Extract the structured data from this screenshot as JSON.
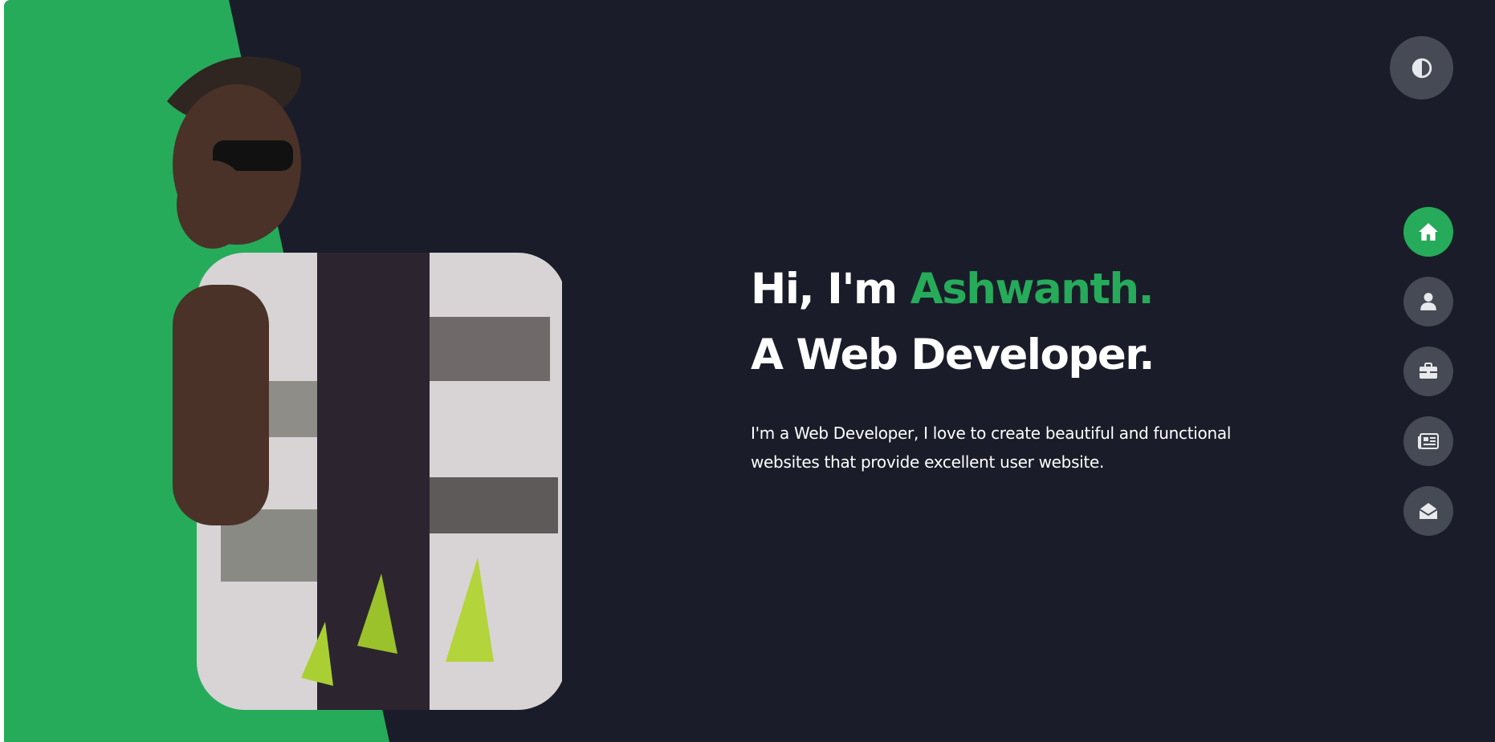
{
  "hero": {
    "greeting_prefix": "Hi, I'm ",
    "name": "Ashwanth.",
    "role": "A Web Developer.",
    "intro_line1": "I'm a Web Developer, I love to create beautiful and functional",
    "intro_line2": "websites that provide excellent user website."
  },
  "theme_toggle": {
    "icon": "contrast-icon"
  },
  "nav": {
    "items": [
      {
        "icon": "home-icon",
        "active": true
      },
      {
        "icon": "user-icon",
        "active": false
      },
      {
        "icon": "briefcase-icon",
        "active": false
      },
      {
        "icon": "newspaper-icon",
        "active": false
      },
      {
        "icon": "envelope-open-icon",
        "active": false
      }
    ]
  },
  "colors": {
    "background": "#1a1d29",
    "accent": "#26ab5a",
    "button": "#454a54",
    "icon": "#e8e9ec",
    "text": "#ffffff"
  }
}
